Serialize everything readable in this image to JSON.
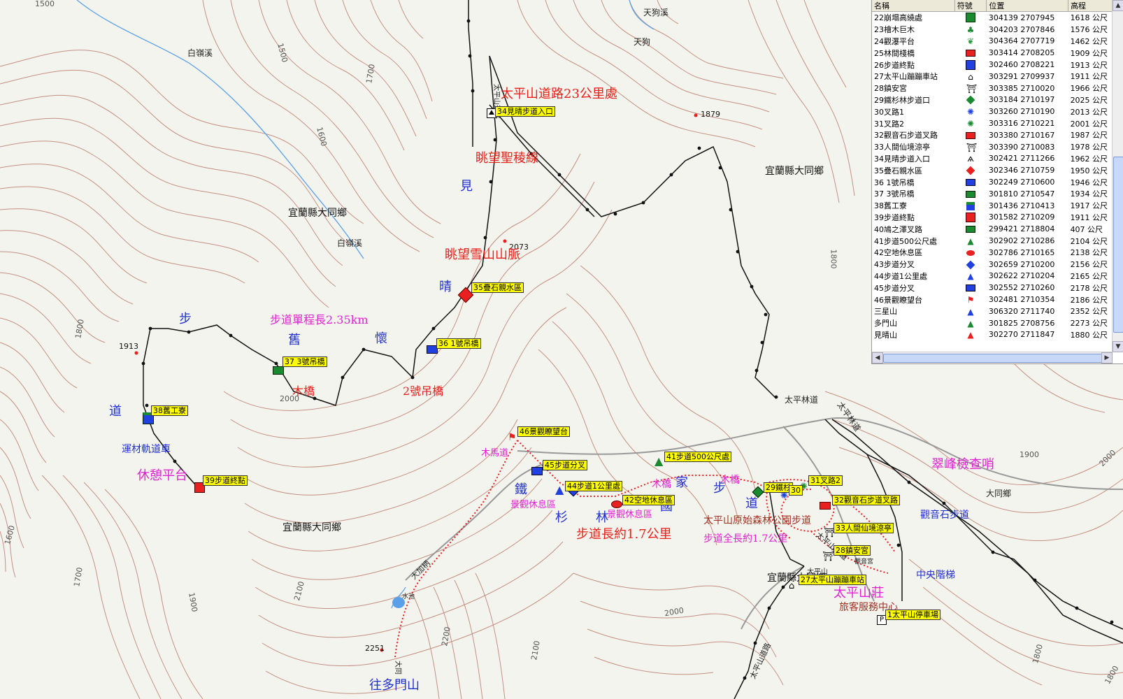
{
  "map": {
    "contour_labels": [
      "1500",
      "1500",
      "1700",
      "1600",
      "1800",
      "1800",
      "1600",
      "1700",
      "1900",
      "2000",
      "2100",
      "2200",
      "2100",
      "2000",
      "1900",
      "1800",
      "1800",
      "2000"
    ],
    "elevations": [
      "1879",
      "2073",
      "1913",
      "2251"
    ],
    "regions": [
      "宜蘭縣大同鄉",
      "宜蘭縣大同鄉",
      "宜蘭縣大同鄉",
      "宜蘭縣大同鄉"
    ],
    "small_labels": [
      "白嶺溪",
      "白嶺溪",
      "天狗溪",
      "天狗",
      "太平林道",
      "太平林道",
      "大同鄉",
      "太平山道路",
      "太平山莊道",
      "太平山道路",
      "大加柄",
      "水池",
      "大同",
      "觀音宮",
      "大平山"
    ],
    "annotations": {
      "road23": "太平山道路23公里處",
      "view_ridge": "眺望聖稜線",
      "view_snow": "眺望雪山山脈",
      "trail_len": "步道單程長2.35km",
      "wood_bridge": "木橋",
      "bridge2": "2號吊橋",
      "jian": "見",
      "qing": "晴",
      "huai": "懷",
      "jiu": "舊",
      "bu": "步",
      "dao": "道",
      "yun": "運材軌道車",
      "rest": "休憩平台",
      "wood_horse": "木馬道",
      "scenic1": "景觀休息區",
      "scenic2": "景觀休息區",
      "tie": "鐵",
      "shan": "杉",
      "lin": "林",
      "trail17": "步道長約1.7公里",
      "wood_bridge2": "木橋",
      "jia": "家",
      "guo": "國",
      "wood_bridge3": "木橋",
      "bu2": "步",
      "dao2": "道",
      "park": "太平山原始森林公園步道",
      "park_len": "步道全長約1.7公里",
      "cuifeng": "翠峰檢查哨",
      "guanyin": "觀音石步道",
      "central": "中央階梯",
      "taipingshan": "太平山莊",
      "service": "旅客服務中心",
      "duomen": "往多門山"
    },
    "waypoints": [
      {
        "id": "w34",
        "label": "34見晴步道入口"
      },
      {
        "id": "w35",
        "label": "35疊石親水區"
      },
      {
        "id": "w36",
        "label": "36 1號吊橋"
      },
      {
        "id": "w37",
        "label": "37 3號吊橋"
      },
      {
        "id": "w38",
        "label": "38舊工寮"
      },
      {
        "id": "w39",
        "label": "39步道終點"
      },
      {
        "id": "w46",
        "label": "46景觀瞭望台"
      },
      {
        "id": "w45",
        "label": "45步道分叉"
      },
      {
        "id": "w44",
        "label": "44步道1公里處"
      },
      {
        "id": "w41",
        "label": "41步道500公尺處"
      },
      {
        "id": "w42",
        "label": "42空地休息區"
      },
      {
        "id": "w29",
        "label": "29鐵杉"
      },
      {
        "id": "w30",
        "label": "30"
      },
      {
        "id": "w31",
        "label": "31叉路2"
      },
      {
        "id": "w32",
        "label": "32觀音石步道叉路"
      },
      {
        "id": "w33",
        "label": "33人間仙境涼亭"
      },
      {
        "id": "w28",
        "label": "28鎮安宮"
      },
      {
        "id": "w27",
        "label": "27太平山蹦蹦車站"
      },
      {
        "id": "w1",
        "label": "1太平山停車場"
      }
    ]
  },
  "panel": {
    "headers": [
      "名稱",
      "符號",
      "位置",
      "高程"
    ],
    "rows": [
      {
        "name": "22崩塌高繞處",
        "sym": "green-cube",
        "pos": "304139 2707945",
        "elev": "1618 公尺"
      },
      {
        "name": "23檜木巨木",
        "sym": "tree",
        "pos": "304203 2707846",
        "elev": "1576 公尺"
      },
      {
        "name": "24觀瀑平台",
        "sym": "leaf",
        "pos": "304364 2707719",
        "elev": "1462 公尺"
      },
      {
        "name": "25林間棧橋",
        "sym": "red-rect",
        "pos": "303414 2708205",
        "elev": "1909 公尺"
      },
      {
        "name": "26步道終點",
        "sym": "blue-square",
        "pos": "302460 2708221",
        "elev": "1913 公尺"
      },
      {
        "name": "27太平山蹦蹦車站",
        "sym": "house",
        "pos": "303291 2709937",
        "elev": "1911 公尺"
      },
      {
        "name": "28鎮安宮",
        "sym": "temple",
        "pos": "303385 2710020",
        "elev": "1966 公尺"
      },
      {
        "name": "29鐵杉林步道口",
        "sym": "green-diamond",
        "pos": "303184 2710197",
        "elev": "2025 公尺"
      },
      {
        "name": "30叉路1",
        "sym": "blue-sun",
        "pos": "303260 2710190",
        "elev": "2013 公尺"
      },
      {
        "name": "31叉路2",
        "sym": "green-sun",
        "pos": "303316 2710221",
        "elev": "2001 公尺"
      },
      {
        "name": "32觀音石步道叉路",
        "sym": "red-rect",
        "pos": "303380 2710167",
        "elev": "1987 公尺"
      },
      {
        "name": "33人間仙境涼亭",
        "sym": "temple",
        "pos": "303390 2710083",
        "elev": "1978 公尺"
      },
      {
        "name": "34見晴步道入口",
        "sym": "hiker",
        "pos": "302421 2711266",
        "elev": "1962 公尺"
      },
      {
        "name": "35疊石親水區",
        "sym": "red-diamond",
        "pos": "302346 2710759",
        "elev": "1950 公尺"
      },
      {
        "name": "36 1號吊橋",
        "sym": "blue-rect",
        "pos": "302249 2710600",
        "elev": "1946 公尺"
      },
      {
        "name": "37 3號吊橋",
        "sym": "green-rect",
        "pos": "301810 2710547",
        "elev": "1934 公尺"
      },
      {
        "name": "38舊工寮",
        "sym": "hut",
        "pos": "301436 2710413",
        "elev": "1917 公尺"
      },
      {
        "name": "39步道終點",
        "sym": "red-cube",
        "pos": "301582 2710209",
        "elev": "1911 公尺"
      },
      {
        "name": "40鳩之澤叉路",
        "sym": "green-rect",
        "pos": "299421 2718804",
        "elev": "407 公尺"
      },
      {
        "name": "41步道500公尺處",
        "sym": "green-tri",
        "pos": "302902 2710286",
        "elev": "2104 公尺"
      },
      {
        "name": "42空地休息區",
        "sym": "red-oval",
        "pos": "302786 2710165",
        "elev": "2138 公尺"
      },
      {
        "name": "43步道分叉",
        "sym": "blue-diamond",
        "pos": "302659 2710200",
        "elev": "2156 公尺"
      },
      {
        "name": "44步道1公里處",
        "sym": "blue-tri",
        "pos": "302622 2710204",
        "elev": "2165 公尺"
      },
      {
        "name": "45步道分叉",
        "sym": "blue-rect",
        "pos": "302552 2710260",
        "elev": "2178 公尺"
      },
      {
        "name": "46景觀瞭望台",
        "sym": "red-flag",
        "pos": "302481 2710354",
        "elev": "2186 公尺"
      },
      {
        "name": "三星山",
        "sym": "blue-tri",
        "pos": "306320 2711740",
        "elev": "2352 公尺"
      },
      {
        "name": "多門山",
        "sym": "green-tri",
        "pos": "301825 2708756",
        "elev": "2273 公尺"
      },
      {
        "name": "見晴山",
        "sym": "red-tri",
        "pos": "302270 2711847",
        "elev": "1880 公尺"
      }
    ]
  },
  "colors": {
    "contour": "#b87060",
    "trail_black": "#111111",
    "trail_red": "#e82020",
    "river": "#5aa0e8",
    "road": "#888888",
    "waypoint_bg": "#ffff00"
  }
}
